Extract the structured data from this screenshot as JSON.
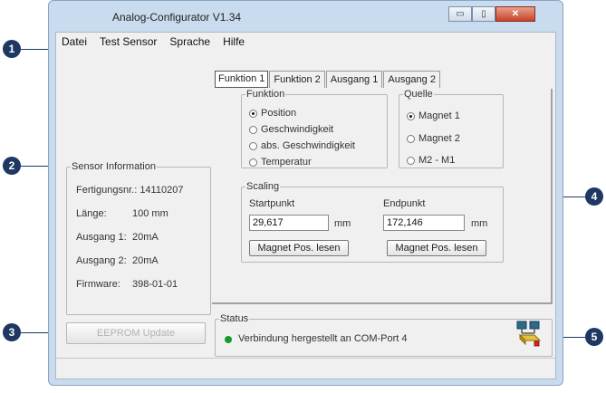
{
  "window": {
    "title": "Analog-Configurator V1.34"
  },
  "title_buttons": {
    "minimize": "▭",
    "maximize": "▯",
    "close": "✕"
  },
  "menu": [
    "Datei",
    "Test Sensor",
    "Sprache",
    "Hilfe"
  ],
  "tabs": [
    "Funktion 1",
    "Funktion 2",
    "Ausgang 1",
    "Ausgang 2"
  ],
  "funktion": {
    "legend": "Funktion",
    "options": [
      "Position",
      "Geschwindigkeit",
      "abs. Geschwindigkeit",
      "Temperatur"
    ],
    "selected": "Position"
  },
  "quelle": {
    "legend": "Quelle",
    "options": [
      "Magnet 1",
      "Magnet 2",
      "M2 - M1"
    ],
    "selected": "Magnet 1"
  },
  "scaling": {
    "legend": "Scaling",
    "start_label": "Startpunkt",
    "start_value": "29,617",
    "start_unit": "mm",
    "end_label": "Endpunkt",
    "end_value": "172,146",
    "end_unit": "mm",
    "read_button": "Magnet Pos. lesen"
  },
  "sensor_info": {
    "legend": "Sensor Information",
    "fertigungsnr": "Fertigungsnr.: 14110207",
    "laenge_label": "Länge:",
    "laenge_value": "100 mm",
    "ausgang1_label": "Ausgang 1:",
    "ausgang1_value": "20mA",
    "ausgang2_label": "Ausgang 2:",
    "ausgang2_value": "20mA",
    "firmware_label": "Firmware:",
    "firmware_value": "398-01-01"
  },
  "eeprom_button": "EEPROM Update",
  "status": {
    "legend": "Status",
    "text": "Verbindung hergestellt an COM-Port 4",
    "indicator_color": "#169a2f",
    "icon": "network-computers-icon"
  },
  "callouts": [
    "1",
    "2",
    "3",
    "4",
    "5"
  ],
  "accent_color": "#1e3763"
}
